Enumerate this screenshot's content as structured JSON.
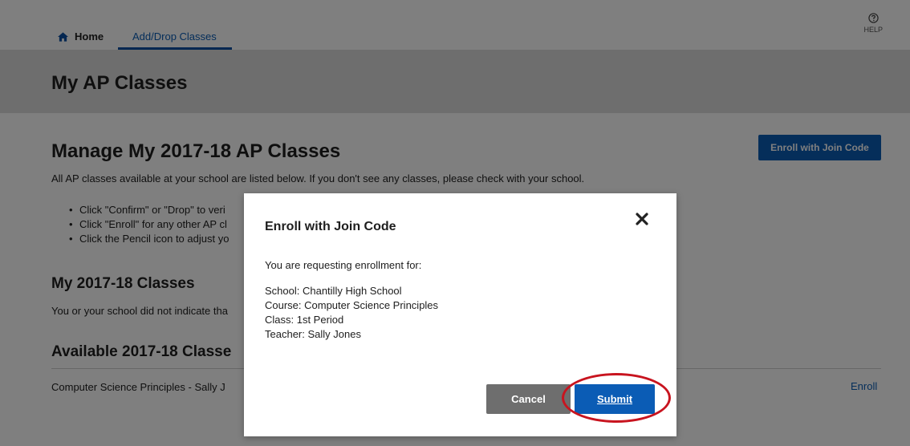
{
  "nav": {
    "home_label": "Home",
    "add_drop_label": "Add/Drop Classes",
    "help_label": "HELP"
  },
  "page": {
    "title": "My AP Classes",
    "manage_heading": "Manage My 2017-18 AP Classes",
    "enroll_join_button": "Enroll with Join Code",
    "intro": "All AP classes available at your school are listed below. If you don't see any classes, please check with your school.",
    "bullets": [
      "Click \"Confirm\" or \"Drop\" to veri",
      "Click \"Enroll\" for any other AP cl",
      "Click the Pencil icon to adjust yo"
    ],
    "my_classes_heading": "My 2017-18 Classes",
    "my_classes_text": "You or your school did not indicate tha",
    "available_heading": "Available 2017-18 Classe",
    "available_row": "Computer Science Principles - Sally J",
    "enroll_link": "Enroll"
  },
  "modal": {
    "title": "Enroll with Join Code",
    "requesting": "You are requesting enrollment for:",
    "school": "School: Chantilly High School",
    "course": "Course: Computer Science Principles",
    "class": "Class: 1st Period",
    "teacher": "Teacher: Sally Jones",
    "cancel_label": "Cancel",
    "submit_label": "Submit"
  },
  "colors": {
    "primary": "#0b5cb5",
    "highlight_ring": "#c8141f",
    "cancel": "#6e6e6e"
  }
}
